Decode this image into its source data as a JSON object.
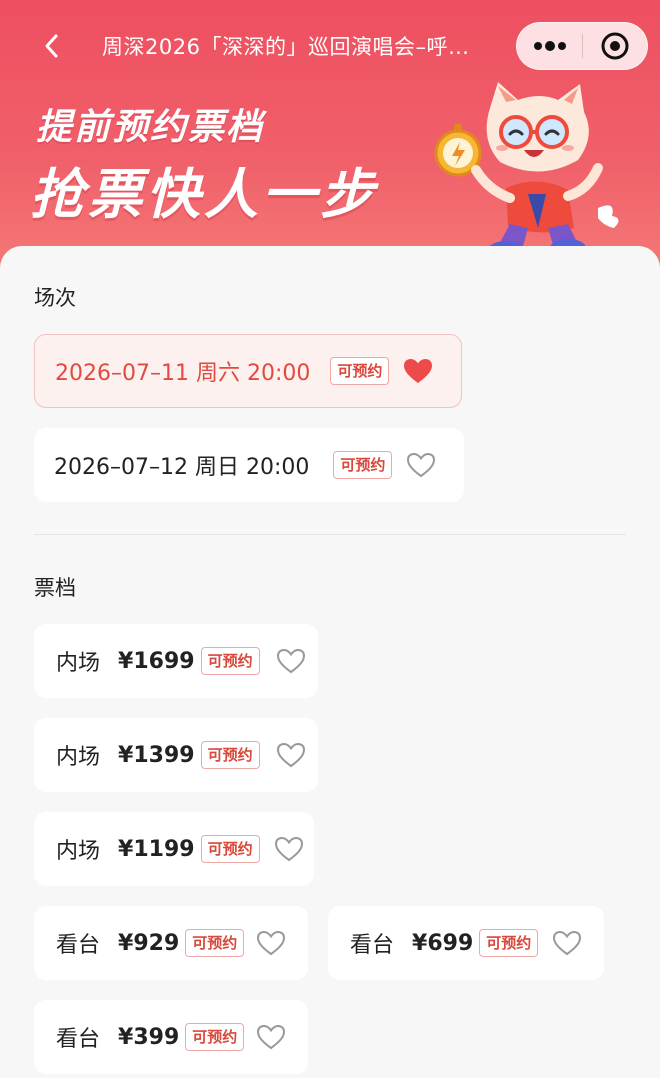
{
  "nav": {
    "back_icon": "chevron-left-icon",
    "title": "周深2026「深深的」巡回演唱会–呼…",
    "more_icon": "more-dots-icon",
    "close_icon": "target-close-icon"
  },
  "hero": {
    "slogan_line1": "提前预约票档",
    "slogan_line2": "抢票快人一步",
    "mascot_icon": "cat-mascot-stopwatch-icon"
  },
  "colors": {
    "hero_top": "#ee4f60",
    "accent": "#e14b3f",
    "badge_border": "#f0a9a2",
    "heart_filled": "#ee4a4a"
  },
  "sessions": {
    "label": "场次",
    "items": [
      {
        "text": "2026–07–11 周六 20:00",
        "badge": "可预约",
        "selected": true
      },
      {
        "text": "2026–07–12 周日 20:00",
        "badge": "可预约",
        "selected": false
      }
    ]
  },
  "tiers": {
    "label": "票档",
    "items": [
      {
        "type": "内场",
        "price": "¥1699",
        "badge": "可预约"
      },
      {
        "type": "内场",
        "price": "¥1399",
        "badge": "可预约"
      },
      {
        "type": "内场",
        "price": "¥1199",
        "badge": "可预约"
      },
      {
        "type": "看台",
        "price": "¥929",
        "badge": "可预约"
      },
      {
        "type": "看台",
        "price": "¥699",
        "badge": "可预约"
      },
      {
        "type": "看台",
        "price": "¥399",
        "badge": "可预约"
      }
    ]
  }
}
